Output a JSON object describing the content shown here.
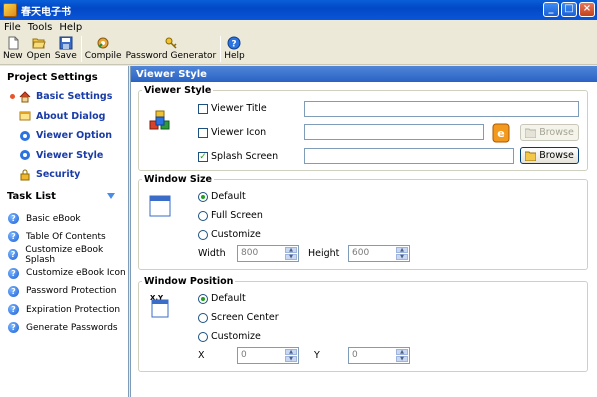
{
  "window": {
    "title": "春天电子书"
  },
  "menu": [
    "File",
    "Tools",
    "Help"
  ],
  "toolbar": {
    "new": "New",
    "open": "Open",
    "save": "Save",
    "compile": "Compile",
    "password_generator": "Password Generator",
    "help": "Help"
  },
  "sidebar": {
    "project_settings_title": "Project Settings",
    "items": [
      {
        "label": "Basic Settings"
      },
      {
        "label": "About Dialog"
      },
      {
        "label": "Viewer Option"
      },
      {
        "label": "Viewer Style"
      },
      {
        "label": "Security"
      }
    ],
    "task_list_title": "Task List",
    "tasks": [
      {
        "label": "Basic eBook"
      },
      {
        "label": "Table Of Contents"
      },
      {
        "label": "Customize eBook Splash"
      },
      {
        "label": "Customize eBook Icon"
      },
      {
        "label": "Password Protection"
      },
      {
        "label": "Expiration Protection"
      },
      {
        "label": "Generate Passwords"
      }
    ]
  },
  "main": {
    "header": "Viewer Style",
    "viewer_style": {
      "legend": "Viewer Style",
      "viewer_title_label": "Viewer Title",
      "viewer_icon_label": "Viewer Icon",
      "splash_screen_label": "Splash Screen",
      "browse_label": "Browse",
      "splash_checked": true
    },
    "window_size": {
      "legend": "Window Size",
      "options": [
        "Default",
        "Full Screen",
        "Customize"
      ],
      "selected": "Default",
      "width_label": "Width",
      "width_value": "800",
      "height_label": "Height",
      "height_value": "600"
    },
    "window_position": {
      "legend": "Window Position",
      "options": [
        "Default",
        "Screen Center",
        "Customize"
      ],
      "selected": "Default",
      "x_label": "X",
      "x_value": "0",
      "y_label": "Y",
      "y_value": "0"
    }
  }
}
